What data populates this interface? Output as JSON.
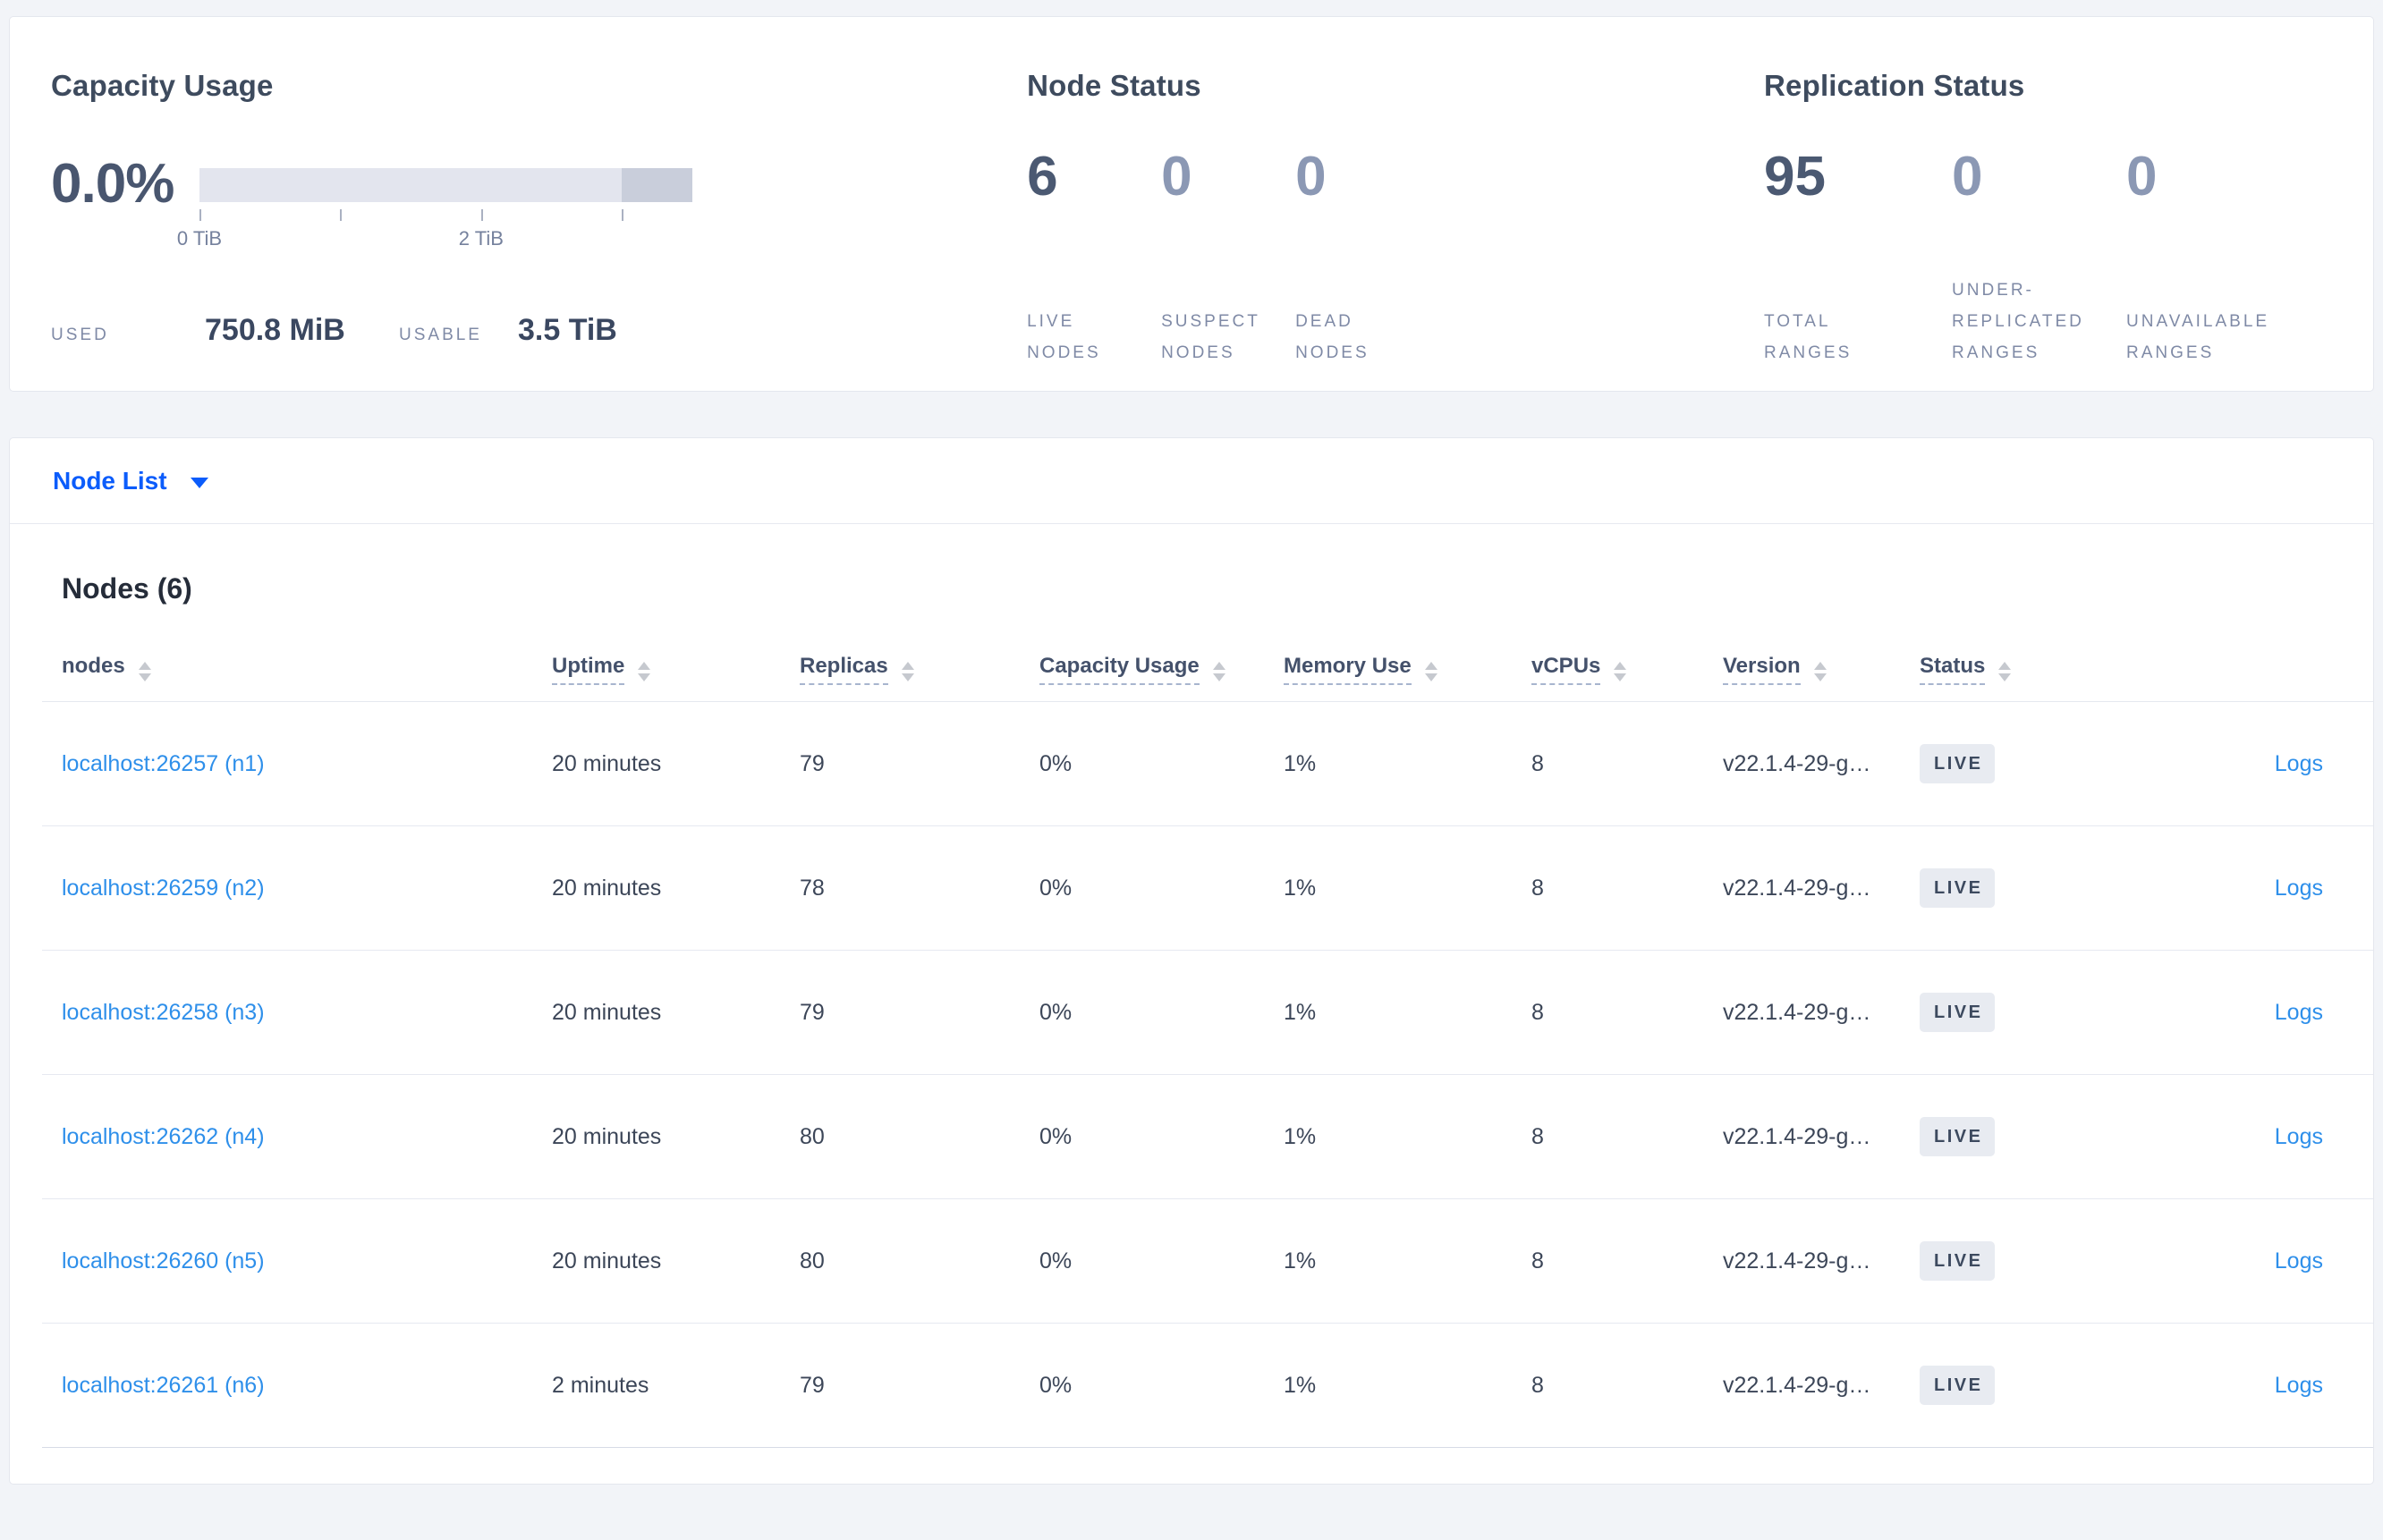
{
  "summary": {
    "capacity": {
      "title": "Capacity Usage",
      "percent_used": "0.0%",
      "bar": {
        "total": "3.5 TiB",
        "track_color": "#e3e5ee",
        "tail_color": "#c9cedb",
        "tick_labels": [
          "0 TiB",
          "2 TiB"
        ]
      },
      "used_label": "USED",
      "used_value": "750.8 MiB",
      "usable_label": "USABLE",
      "usable_value": "3.5 TiB"
    },
    "node_status": {
      "title": "Node Status",
      "stats": [
        {
          "value": "6",
          "label": "LIVE NODES"
        },
        {
          "value": "0",
          "label": "SUSPECT NODES"
        },
        {
          "value": "0",
          "label": "DEAD NODES"
        }
      ]
    },
    "replication_status": {
      "title": "Replication Status",
      "stats": [
        {
          "value": "95",
          "label": "TOTAL RANGES"
        },
        {
          "value": "0",
          "label": "UNDER-REPLICATED RANGES"
        },
        {
          "value": "0",
          "label": "UNAVAILABLE RANGES"
        }
      ]
    }
  },
  "view_selector": {
    "label": "Node List",
    "icon": "caret-down-icon"
  },
  "nodes_table": {
    "heading": "Nodes (6)",
    "columns": [
      {
        "label": "nodes"
      },
      {
        "label": "Uptime"
      },
      {
        "label": "Replicas"
      },
      {
        "label": "Capacity Usage"
      },
      {
        "label": "Memory Use"
      },
      {
        "label": "vCPUs"
      },
      {
        "label": "Version"
      },
      {
        "label": "Status"
      }
    ],
    "rows": [
      {
        "node": "localhost:26257 (n1)",
        "uptime": "20 minutes",
        "replicas": "79",
        "capacity_usage": "0%",
        "memory_use": "1%",
        "vcpus": "8",
        "version": "v22.1.4-29-g…",
        "status": "LIVE",
        "logs": "Logs"
      },
      {
        "node": "localhost:26259 (n2)",
        "uptime": "20 minutes",
        "replicas": "78",
        "capacity_usage": "0%",
        "memory_use": "1%",
        "vcpus": "8",
        "version": "v22.1.4-29-g…",
        "status": "LIVE",
        "logs": "Logs"
      },
      {
        "node": "localhost:26258 (n3)",
        "uptime": "20 minutes",
        "replicas": "79",
        "capacity_usage": "0%",
        "memory_use": "1%",
        "vcpus": "8",
        "version": "v22.1.4-29-g…",
        "status": "LIVE",
        "logs": "Logs"
      },
      {
        "node": "localhost:26262 (n4)",
        "uptime": "20 minutes",
        "replicas": "80",
        "capacity_usage": "0%",
        "memory_use": "1%",
        "vcpus": "8",
        "version": "v22.1.4-29-g…",
        "status": "LIVE",
        "logs": "Logs"
      },
      {
        "node": "localhost:26260 (n5)",
        "uptime": "20 minutes",
        "replicas": "80",
        "capacity_usage": "0%",
        "memory_use": "1%",
        "vcpus": "8",
        "version": "v22.1.4-29-g…",
        "status": "LIVE",
        "logs": "Logs"
      },
      {
        "node": "localhost:26261 (n6)",
        "uptime": "2 minutes",
        "replicas": "79",
        "capacity_usage": "0%",
        "memory_use": "1%",
        "vcpus": "8",
        "version": "v22.1.4-29-g…",
        "status": "LIVE",
        "logs": "Logs"
      }
    ]
  },
  "colors": {
    "accent_blue": "#0b5cfb",
    "link_blue": "#2e8fea",
    "stat_emphasis": "#4b5972",
    "stat_dim": "#8b98b4",
    "badge_bg": "#e8ebf1"
  }
}
